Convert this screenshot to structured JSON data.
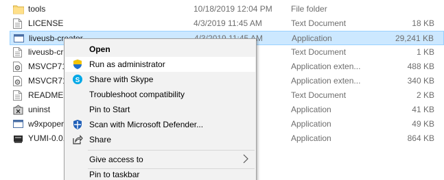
{
  "files": [
    {
      "name": "tools",
      "date": "10/18/2019 12:04 PM",
      "type": "File folder",
      "size": "",
      "icon": "folder-icon"
    },
    {
      "name": "LICENSE",
      "date": "4/3/2019 11:45 AM",
      "type": "Text Document",
      "size": "18 KB",
      "icon": "text-file-icon"
    },
    {
      "name": "liveusb-creator",
      "date": "4/3/2019 11:45 AM",
      "type": "Application",
      "size": "29,241 KB",
      "icon": "app-window-icon"
    },
    {
      "name": "liveusb-cr",
      "date": "",
      "type": "Text Document",
      "size": "1 KB",
      "icon": "text-file-icon"
    },
    {
      "name": "MSVCP71.",
      "date": "",
      "type": "Application exten...",
      "size": "488 KB",
      "icon": "dll-gear-icon"
    },
    {
      "name": "MSVCR71.",
      "date": "",
      "type": "Application exten...",
      "size": "340 KB",
      "icon": "dll-gear-icon"
    },
    {
      "name": "README",
      "date": "",
      "type": "Text Document",
      "size": "2 KB",
      "icon": "text-file-icon"
    },
    {
      "name": "uninst",
      "date": "",
      "type": "Application",
      "size": "41 KB",
      "icon": "uninstaller-icon"
    },
    {
      "name": "w9xpoper",
      "date": "",
      "type": "Application",
      "size": "49 KB",
      "icon": "app-window-icon"
    },
    {
      "name": "YUMI-0.0.",
      "date": "",
      "type": "Application",
      "size": "864 KB",
      "icon": "usb-drive-icon"
    }
  ],
  "context_menu": {
    "items": [
      {
        "label": "Open",
        "bold": true
      },
      {
        "label": "Run as administrator",
        "icon": "uac-shield-icon"
      },
      {
        "label": "Share with Skype",
        "icon": "skype-icon"
      },
      {
        "label": "Troubleshoot compatibility"
      },
      {
        "label": "Pin to Start"
      },
      {
        "label": "Scan with Microsoft Defender...",
        "icon": "defender-icon"
      },
      {
        "label": "Share",
        "icon": "share-icon"
      },
      {
        "label": "Give access to",
        "submenu": true
      },
      {
        "label": "Pin to taskbar"
      }
    ],
    "hovered_index": 1
  },
  "colors": {
    "selection_bg": "#cce8ff",
    "selection_border": "#99d1ff",
    "menu_bg": "#f2f2f2",
    "menu_hover": "#ffffff",
    "secondary_text": "#6d6d6d"
  }
}
